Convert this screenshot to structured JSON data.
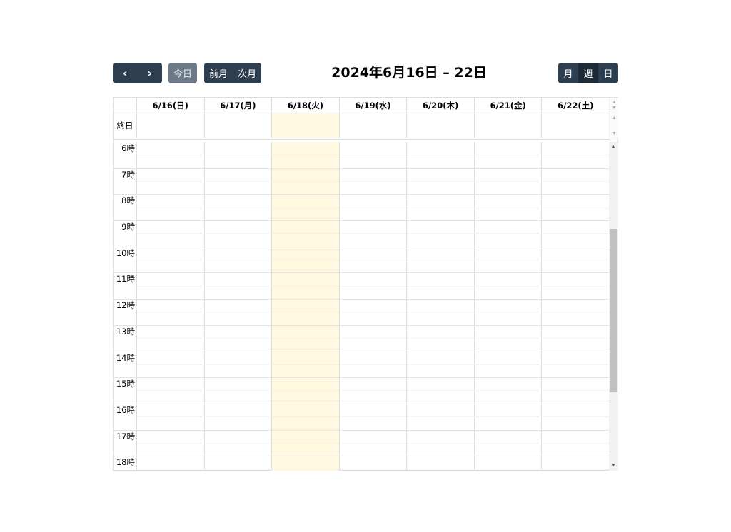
{
  "toolbar": {
    "prev_icon": "‹",
    "next_icon": "›",
    "today_label": "今日",
    "prev_month_label": "前月",
    "next_month_label": "次月",
    "title": "2024年6月16日 – 22日",
    "views": [
      "月",
      "週",
      "日"
    ],
    "active_view": "週"
  },
  "calendar": {
    "days": [
      "6/16(日)",
      "6/17(月)",
      "6/18(火)",
      "6/19(水)",
      "6/20(木)",
      "6/21(金)",
      "6/22(土)"
    ],
    "today_index": 2,
    "allday_label": "終日",
    "hours": [
      "6時",
      "7時",
      "8時",
      "9時",
      "10時",
      "11時",
      "12時",
      "13時",
      "14時",
      "15時",
      "16時",
      "17時",
      "18時"
    ]
  },
  "colors": {
    "button_bg": "#2c3e50",
    "today_highlight": "#fef9e0"
  }
}
